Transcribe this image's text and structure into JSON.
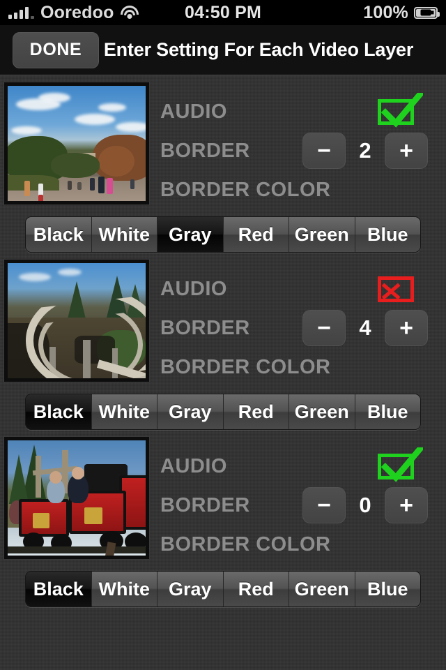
{
  "status_bar": {
    "carrier": "Ooredoo",
    "time": "04:50 PM",
    "battery_percent": "100%",
    "signal_bars_filled": 4,
    "signal_bars_total": 5,
    "wifi_icon": "wifi-icon",
    "battery_icon": "battery-full-icon"
  },
  "nav_bar": {
    "done_label": "DONE",
    "title": "Enter Setting For Each Video Layer"
  },
  "labels": {
    "audio": "AUDIO",
    "border": "BORDER",
    "border_color": "BORDER COLOR",
    "minus": "−",
    "plus": "+"
  },
  "colors": {
    "checked": "#1ed21e",
    "unchecked": "#e81d1d",
    "label_gray": "#8d8d8d",
    "background": "#303030"
  },
  "color_options": [
    "Black",
    "White",
    "Gray",
    "Red",
    "Green",
    "Blue"
  ],
  "layers": [
    {
      "thumbnail_alt": "park-autumn-thumbnail",
      "audio_enabled": true,
      "audio_icon": "checkbox-checked-icon",
      "border_value": "2",
      "selected_color": "Gray"
    },
    {
      "thumbnail_alt": "roller-coaster-thumbnail",
      "audio_enabled": false,
      "audio_icon": "checkbox-x-icon",
      "border_value": "4",
      "selected_color": "Black"
    },
    {
      "thumbnail_alt": "red-train-ride-thumbnail",
      "audio_enabled": true,
      "audio_icon": "checkbox-checked-icon",
      "border_value": "0",
      "selected_color": "Black"
    }
  ]
}
